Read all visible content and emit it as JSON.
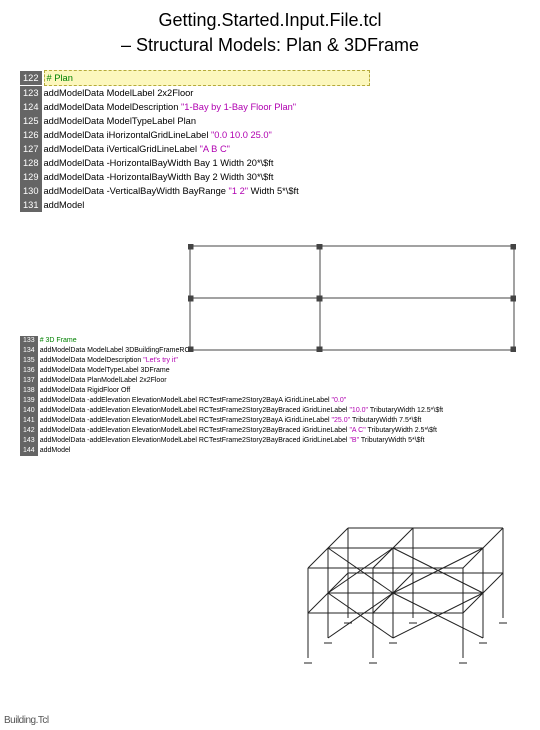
{
  "title": "Getting.Started.Input.File.tcl",
  "subtitle": "– Structural Models: Plan & 3DFrame",
  "corner_label": "Building.Tcl",
  "code_block_1": [
    {
      "n": "122",
      "type": "hlcmt",
      "text": "# Plan"
    },
    {
      "n": "123",
      "tokens": [
        {
          "c": "kw",
          "t": "addModelData "
        },
        {
          "c": "arg",
          "t": "ModelLabel 2x2Floor"
        }
      ]
    },
    {
      "n": "124",
      "tokens": [
        {
          "c": "kw",
          "t": "addModelData "
        },
        {
          "c": "arg",
          "t": "ModelDescription "
        },
        {
          "c": "str",
          "t": "\"1-Bay by 1-Bay Floor Plan\""
        }
      ]
    },
    {
      "n": "125",
      "tokens": [
        {
          "c": "kw",
          "t": "addModelData "
        },
        {
          "c": "arg",
          "t": "ModelTypeLabel Plan"
        }
      ]
    },
    {
      "n": "126",
      "tokens": [
        {
          "c": "kw",
          "t": "addModelData "
        },
        {
          "c": "arg",
          "t": "iHorizontalGridLineLabel "
        },
        {
          "c": "str",
          "t": "\"0.0 10.0 25.0\""
        }
      ]
    },
    {
      "n": "127",
      "tokens": [
        {
          "c": "kw",
          "t": "addModelData "
        },
        {
          "c": "arg",
          "t": "iVerticalGridLineLabel "
        },
        {
          "c": "str",
          "t": "\"A B C\""
        }
      ]
    },
    {
      "n": "128",
      "tokens": [
        {
          "c": "kw",
          "t": "addModelData "
        },
        {
          "c": "arg",
          "t": "-HorizontalBayWidth Bay 1 Width 20*\\$ft"
        }
      ]
    },
    {
      "n": "129",
      "tokens": [
        {
          "c": "kw",
          "t": "addModelData "
        },
        {
          "c": "arg",
          "t": "-HorizontalBayWidth Bay 2 Width 30*\\$ft"
        }
      ]
    },
    {
      "n": "130",
      "tokens": [
        {
          "c": "kw",
          "t": "addModelData "
        },
        {
          "c": "arg",
          "t": "-VerticalBayWidth BayRange "
        },
        {
          "c": "str",
          "t": "\"1 2\""
        },
        {
          "c": "arg",
          "t": " Width 5*\\$ft"
        }
      ]
    },
    {
      "n": "131",
      "tokens": [
        {
          "c": "kw",
          "t": "addModel"
        }
      ]
    }
  ],
  "code_block_2": [
    {
      "n": "133",
      "type": "cmt",
      "text": "# 3D Frame"
    },
    {
      "n": "134",
      "tokens": [
        {
          "c": "kw",
          "t": "addModelData "
        },
        {
          "c": "arg",
          "t": "ModelLabel 3DBuildingFrameRC"
        }
      ]
    },
    {
      "n": "135",
      "tokens": [
        {
          "c": "kw",
          "t": "addModelData "
        },
        {
          "c": "arg",
          "t": "ModelDescription "
        },
        {
          "c": "str",
          "t": "\"Let's try it\""
        }
      ]
    },
    {
      "n": "136",
      "tokens": [
        {
          "c": "kw",
          "t": "addModelData "
        },
        {
          "c": "arg",
          "t": "ModelTypeLabel 3DFrame"
        }
      ]
    },
    {
      "n": "137",
      "tokens": [
        {
          "c": "kw",
          "t": "addModelData "
        },
        {
          "c": "arg",
          "t": "PlanModelLabel 2x2Floor"
        }
      ]
    },
    {
      "n": "138",
      "tokens": [
        {
          "c": "kw",
          "t": "addModelData "
        },
        {
          "c": "arg",
          "t": "RigidFloor Off"
        }
      ]
    },
    {
      "n": "139",
      "tokens": [
        {
          "c": "kw",
          "t": "addModelData "
        },
        {
          "c": "arg",
          "t": "-addElevation ElevationModelLabel RCTestFrame2Story2BayA iGridLineLabel "
        },
        {
          "c": "str",
          "t": "\"0.0\""
        }
      ]
    },
    {
      "n": "140",
      "tokens": [
        {
          "c": "kw",
          "t": "addModelData "
        },
        {
          "c": "arg",
          "t": "-addElevation ElevationModelLabel RCTestFrame2Story2BayBraced iGridLineLabel "
        },
        {
          "c": "str",
          "t": "\"10.0\""
        },
        {
          "c": "arg",
          "t": " TributaryWidth 12.5*\\$ft"
        }
      ]
    },
    {
      "n": "141",
      "tokens": [
        {
          "c": "kw",
          "t": "addModelData "
        },
        {
          "c": "arg",
          "t": "-addElevation ElevationModelLabel RCTestFrame2Story2BayA iGridLineLabel "
        },
        {
          "c": "str",
          "t": "\"25.0\""
        },
        {
          "c": "arg",
          "t": " TributaryWidth 7.5*\\$ft"
        }
      ]
    },
    {
      "n": "142",
      "tokens": [
        {
          "c": "kw",
          "t": "addModelData "
        },
        {
          "c": "arg",
          "t": "-addElevation ElevationModelLabel RCTestFrame2Story2BayBraced iGridLineLabel "
        },
        {
          "c": "str",
          "t": "\"A C\""
        },
        {
          "c": "arg",
          "t": " TributaryWidth 2.5*\\$ft"
        }
      ]
    },
    {
      "n": "143",
      "tokens": [
        {
          "c": "kw",
          "t": "addModelData "
        },
        {
          "c": "arg",
          "t": "-addElevation ElevationModelLabel RCTestFrame2Story2BayBraced iGridLineLabel "
        },
        {
          "c": "str",
          "t": "\"B\""
        },
        {
          "c": "arg",
          "t": " TributaryWidth 5*\\$ft"
        }
      ]
    },
    {
      "n": "144",
      "tokens": [
        {
          "c": "kw",
          "t": "addModel"
        }
      ]
    }
  ]
}
